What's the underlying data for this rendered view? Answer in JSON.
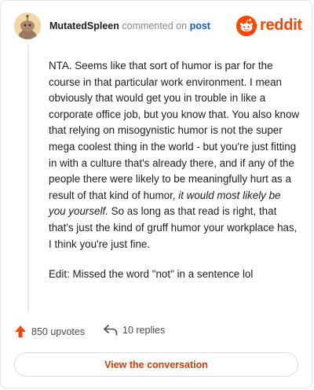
{
  "comment": {
    "username": "MutatedSpleen",
    "action_text": "commented on",
    "post_link": "post",
    "body_segments": [
      "NTA. Seems like that sort of humor is par for the course in that particular work environment. I mean obviously that would get you in trouble in like a corporate office job, but you know that. You also know that relying on misogynistic humor is not the super mega coolest thing in the world - but you're just fitting in with a culture that's already there, and if any of the people there were likely to be meaningfully hurt as a result of that kind of humor, ",
      "it would most likely be you yourself.",
      " So as long as that read is right, that that's just the kind of gruff humor your workplace has, I think you're just fine."
    ],
    "edit_text": "Edit: Missed the word \"not\" in a sentence lol"
  },
  "brand": {
    "wordmark": "reddit",
    "color": "#ff4500"
  },
  "actions": {
    "upvotes": "850 upvotes",
    "replies": "10 replies"
  },
  "cta": {
    "label": "View the conversation"
  }
}
